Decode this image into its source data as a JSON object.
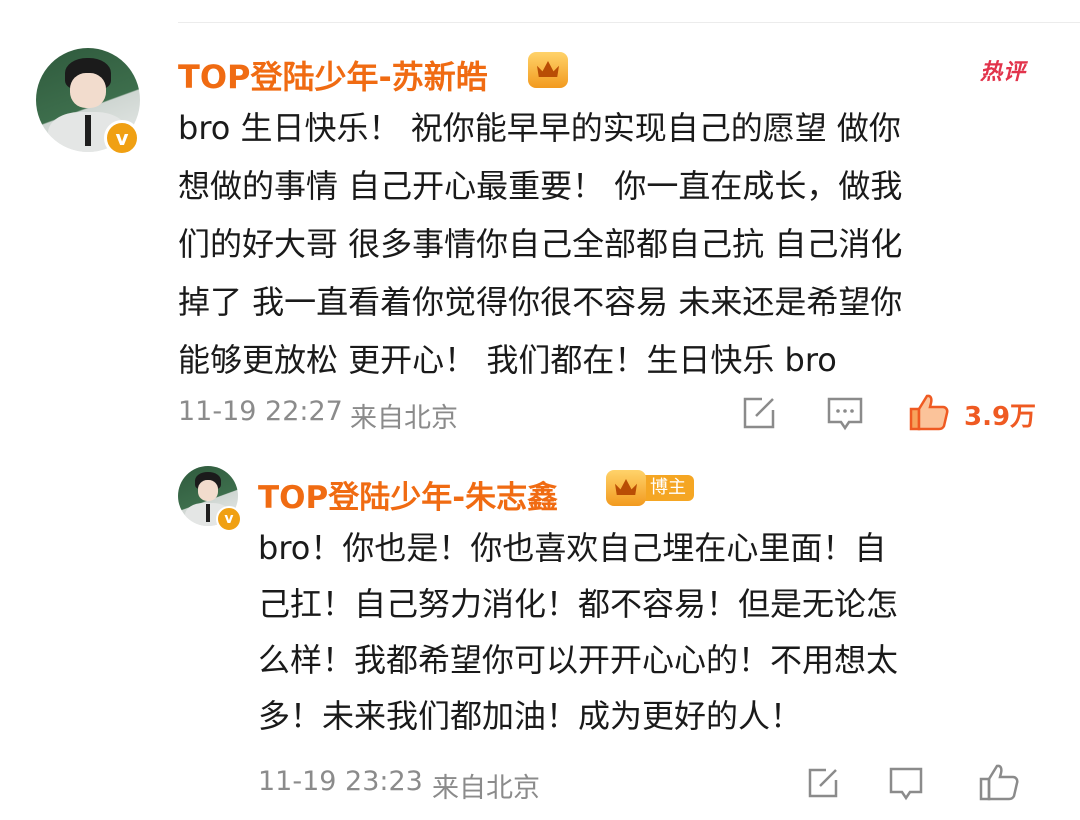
{
  "comment": {
    "username": "TOP登陆少年-苏新皓",
    "hot_label": "热评",
    "lines": [
      "bro 生日快乐！ 祝你能早早的实现自己的愿望 做你",
      "想做的事情 自己开心最重要！ 你一直在成长，做我",
      "们的好大哥 很多事情你自己全部都自己抗 自己消化",
      "掉了 我一直看着你觉得你很不容易 未来还是希望你",
      "能够更放松 更开心！ 我们都在！生日快乐 bro"
    ],
    "time": "11-19 22:27",
    "location": "来自北京",
    "likes": "3.9万",
    "verified_mark": "v"
  },
  "reply": {
    "username": "TOP登陆少年-朱志鑫",
    "badge_label": "博主",
    "lines": [
      "bro！你也是！你也喜欢自己埋在心里面！自",
      "己扛！自己努力消化！都不容易！但是无论怎",
      "么样！我都希望你可以开开心心的！不用想太",
      "多！未来我们都加油！成为更好的人！"
    ],
    "time": "11-19 23:23",
    "location": "来自北京",
    "verified_mark": "v"
  },
  "icons": [
    "share-icon",
    "comment-icon",
    "like-icon"
  ],
  "colors": {
    "username": "#f06b12",
    "hot": "#e2334b",
    "like": "#ef5a22",
    "meta": "#8b8b8b"
  }
}
